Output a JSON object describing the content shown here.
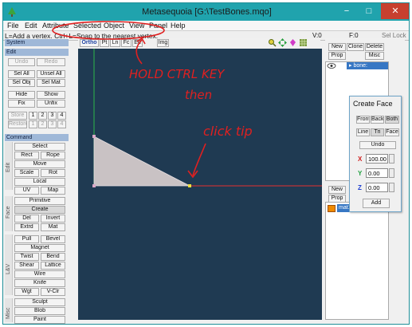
{
  "window": {
    "title": "Metasequoia [G:\\TestBones.mqo]",
    "accent_color": "#20a3ad",
    "controls": {
      "minimize": "−",
      "maximize": "□",
      "close": "✕"
    }
  },
  "menu": [
    "File",
    "Edit",
    "Attribute",
    "Selected",
    "Object",
    "View",
    "Panel",
    "Help"
  ],
  "status": {
    "hint": "L=Add a vertex. Ctrl+L=Snap to the nearest vertex.",
    "v": "V:0",
    "f": "F:0",
    "lock": "Sel Lock"
  },
  "left_panel": {
    "system": "System",
    "edit": {
      "header": "Edit",
      "undo": "Undo",
      "redo": "Redo",
      "sel_all": "Sel All",
      "unsel_all": "Unsel All",
      "sel_obj": "Sel Obj",
      "sel_mat": "Sel Mat",
      "hide": "Hide",
      "show": "Show",
      "fix": "Fix",
      "unfix": "Unfix",
      "store": "Store",
      "restore": "Restore",
      "slots": [
        "1",
        "2",
        "3",
        "4"
      ]
    },
    "command": {
      "header": "Command",
      "edit_tab": "Edit",
      "face_tab": "Face",
      "lv_tab": "L&V",
      "misc_tab": "Misc",
      "select": "Select",
      "rect": "Rect",
      "rope": "Rope",
      "move": "Move",
      "scale": "Scale",
      "rot": "Rot",
      "local": "Local",
      "uv": "UV",
      "map": "Map",
      "primitive": "Primitive",
      "create": "Create",
      "del": "Del",
      "invert": "Invert",
      "extrd": "Extrd",
      "mat": "Mat",
      "pull": "Pull",
      "bevel": "Bevel",
      "magnet": "Magnet",
      "twist": "Twist",
      "bend": "Bend",
      "shear": "Shear",
      "lattice": "Lattice",
      "wire": "Wire",
      "knife": "Knife",
      "wgt": "Wgt",
      "vclr": "V-Clr",
      "sculpt": "Sculpt",
      "blob": "Blob",
      "paint": "Paint"
    }
  },
  "view_tabs": [
    "Ortho",
    "Pt",
    "Ln",
    "Fc",
    "Ed",
    "Img"
  ],
  "tool_icons": [
    "magnify-icon",
    "move-arrows-icon",
    "rotate-icon",
    "grid-icon"
  ],
  "object_panel": {
    "new": "New",
    "clone": "Clone",
    "delete": "Delete",
    "prop": "Prop",
    "misc": "Misc",
    "objects": [
      {
        "name": "bone:"
      }
    ]
  },
  "material_panel": {
    "new": "New",
    "prop": "Prop",
    "materials": [
      {
        "name": "mat1",
        "color": "#f08a00"
      }
    ]
  },
  "create_face": {
    "title": "Create Face",
    "front": "Front",
    "back": "Back",
    "both": "Both",
    "line": "Line",
    "tri": "Tri",
    "face": "Face",
    "undo": "Undo",
    "x_label": "X",
    "y_label": "Y",
    "z_label": "Z",
    "x_value": "100.00",
    "y_value": "0.00",
    "z_value": "0.00",
    "add": "Add"
  },
  "annotations": {
    "line1": "HOLD  CTRL KEY",
    "line2": "then",
    "line3": "click tip",
    "color": "#e02020"
  },
  "scene": {
    "background": "#1f3a52",
    "triangle_fill": "#c9c2c4",
    "x_axis_color": "#e33030",
    "y_axis_color": "#2db84a"
  }
}
